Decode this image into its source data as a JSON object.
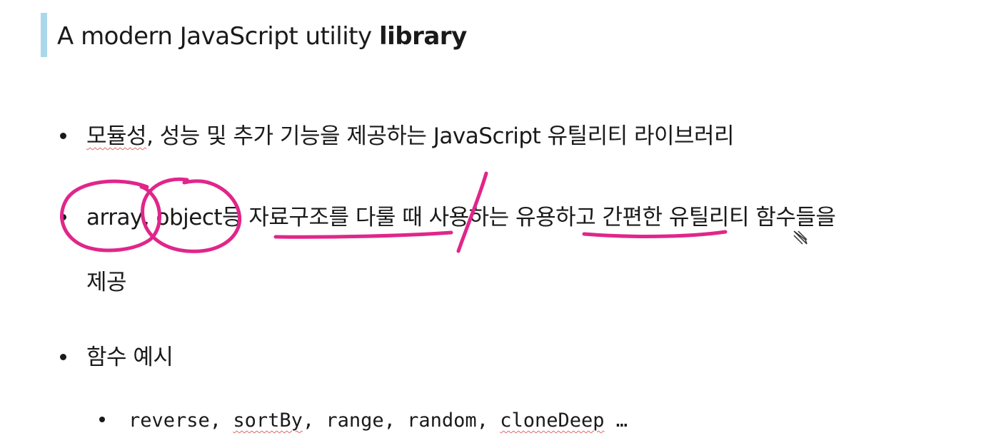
{
  "heading": {
    "text_normal": "A modern JavaScript utility ",
    "text_bold": "library"
  },
  "bullets": [
    {
      "prefix": "모듈성",
      "rest": ", 성능 및 추가 기능을 제공하는 JavaScript 유틸리티 라이브러리"
    },
    {
      "line1": "array, object등 자료구조를 다룰 때 사용하는 유용하고 간편한 유틸리티 함수들을",
      "line2": "제공"
    },
    {
      "text": "함수 예시"
    }
  ],
  "sub_bullet": {
    "before": "reverse, ",
    "sortBy": "sortBy",
    "middle": ", range, random, ",
    "cloneDeep": "cloneDeep",
    "after": " …"
  },
  "annotation_color": "#e0268a",
  "accent_bar_color": "#a9d8ec",
  "icons": [
    "pen-cursor-icon"
  ]
}
